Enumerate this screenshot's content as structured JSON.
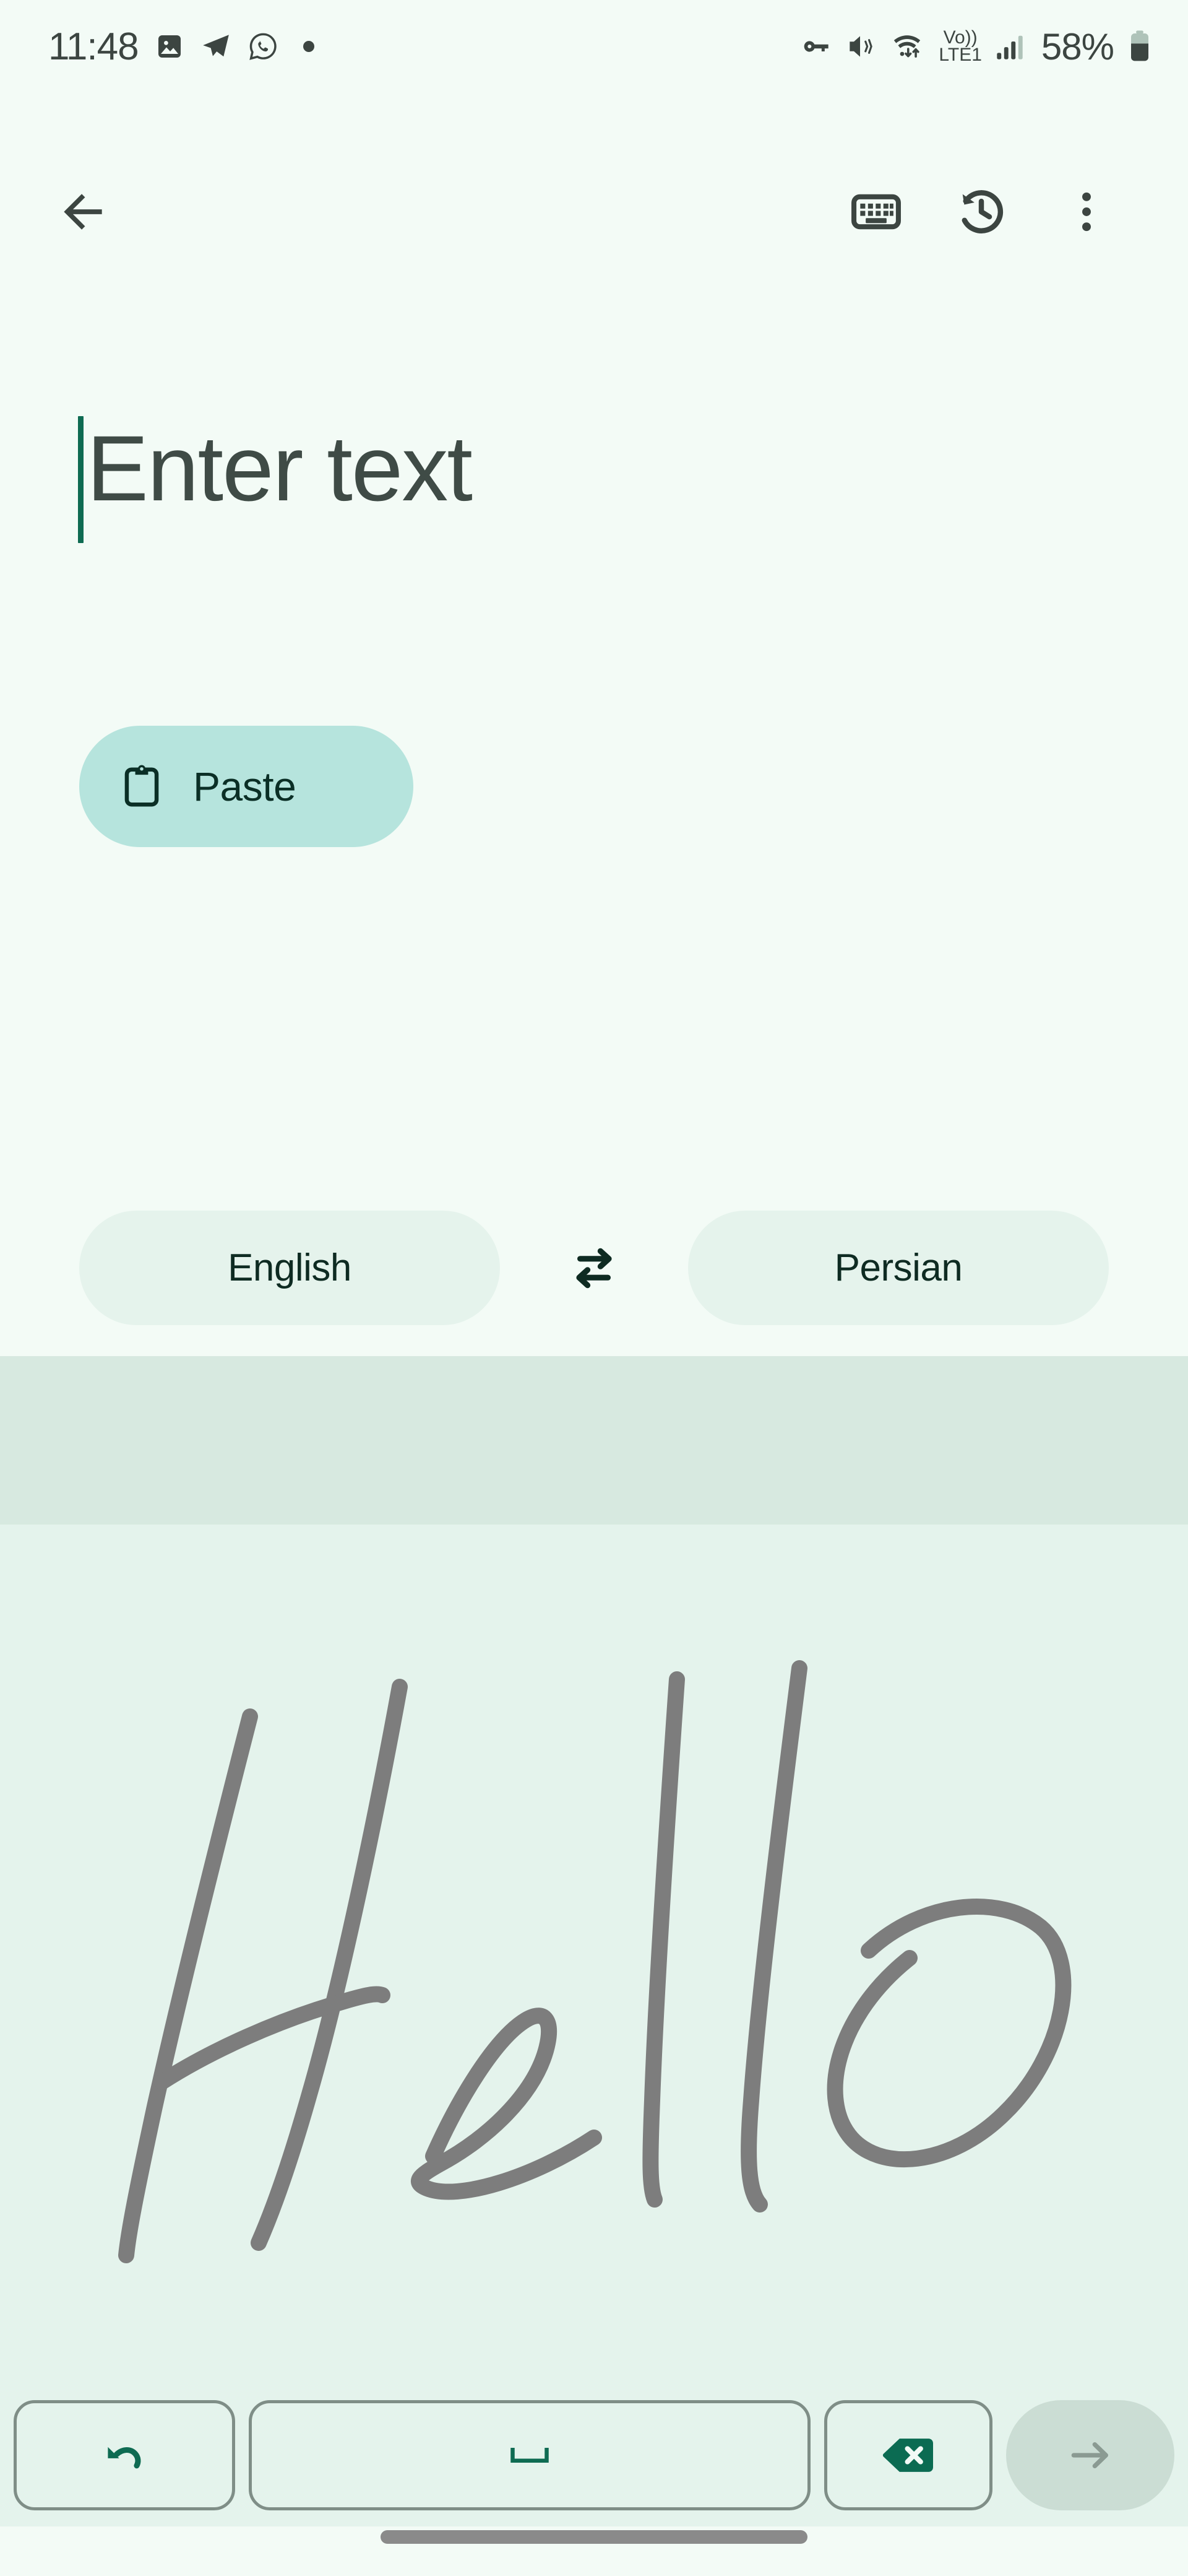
{
  "status_bar": {
    "time": "11:48",
    "battery_percent": "58%",
    "network_label": "LTE1",
    "volte_label": "Vo))",
    "left_icons": [
      "photo-icon",
      "telegram-icon",
      "whatsapp-icon",
      "notification-dot-icon"
    ],
    "right_icons": [
      "vpn-key-icon",
      "volume-vibrate-icon",
      "wifi-data-icon",
      "volte-icon",
      "signal-bars-icon",
      "battery-icon"
    ]
  },
  "app_bar": {
    "back_label": "back-arrow-icon",
    "keyboard_label": "keyboard-icon",
    "history_label": "history-icon",
    "overflow_label": "more-options-icon"
  },
  "input": {
    "placeholder": "Enter text",
    "value": ""
  },
  "paste": {
    "label": "Paste",
    "icon": "clipboard-icon"
  },
  "languages": {
    "source": "English",
    "target": "Persian",
    "swap_icon": "swap-arrows-icon"
  },
  "handwriting": {
    "recognized_text": "Hello",
    "stroke_color": "#7D7D7D"
  },
  "keyboard": {
    "undo_label": "undo-icon",
    "space_label": "space-icon",
    "backspace_label": "backspace-icon",
    "enter_label": "enter-arrow-icon",
    "enter_enabled": "false"
  },
  "colors": {
    "page_background": "#F3FBF6",
    "suggestion_band": "#D7E9E0",
    "canvas_background": "#E4F3EC",
    "paste_background": "#B6E4DD",
    "language_pill": "#E5F3EC",
    "accent_green": "#0E6B52",
    "text_dark": "#3F4B46",
    "key_border": "#7F8E87",
    "enter_disabled": "#CBDDD4"
  }
}
